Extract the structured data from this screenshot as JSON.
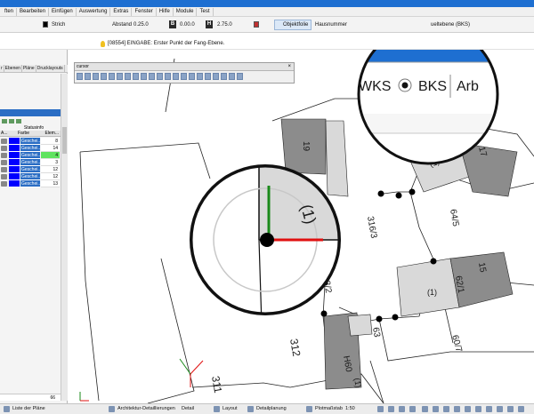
{
  "menu": [
    "ften",
    "Bearbeiten",
    "Einfügen",
    "Auswertung",
    "Extras",
    "Fenster",
    "Hilfe",
    "Module",
    "Test"
  ],
  "props": {
    "line_type": "Strich",
    "abstand_label": "Abstand",
    "abstand_value": "0.25.0",
    "b_label": "B",
    "b_value": "0.00.0",
    "h_label": "H",
    "h_value": "2.75.0",
    "objektfolie": "Objektfolie",
    "hausnummer": "Hausnummer",
    "ebene": "ueltebene (BKS)"
  },
  "status": {
    "message": "[08554] EINGABE: Erster Punkt der Fang-Ebene."
  },
  "left_panel": {
    "tabs": [
      "Ebenen",
      "Pläne",
      "Drucklayouts"
    ],
    "tab_prefix": "r",
    "statusinfo": "Statusinfo",
    "col_farbe": "Farbe",
    "col_elem": "Elem...",
    "col_a": "A...",
    "rows": [
      {
        "name": "Geschei...",
        "count": "8",
        "selected": false
      },
      {
        "name": "Geschei...",
        "count": "14",
        "selected": false
      },
      {
        "name": "Geschei...",
        "count": "4",
        "selected": true
      },
      {
        "name": "Geschei...",
        "count": "3",
        "selected": false
      },
      {
        "name": "Geschei...",
        "count": "12",
        "selected": false
      },
      {
        "name": "Geschei...",
        "count": "12",
        "selected": false
      },
      {
        "name": "Geschei...",
        "count": "13",
        "selected": false
      }
    ],
    "footer_count": "66"
  },
  "cursor_toolbar": {
    "title": "cursor"
  },
  "magnifier": {
    "wks": "WKS",
    "bks": "BKS",
    "arb": "Arb",
    "bks_selected": true,
    "zoom_label": "(1)"
  },
  "plan_labels": {
    "l19": "19",
    "l17": "17",
    "l1a": "(1)",
    "l316": "316/3",
    "l645": "64/5",
    "l15": "15",
    "l621": "62/1",
    "l1b": "(1)",
    "l632": "63/2",
    "l63": "63",
    "l607": "60/7",
    "l312": "312",
    "l311": "311",
    "lh60": "H60",
    "l13": "(1)"
  },
  "bottom": {
    "liste": "Liste der Pläne",
    "architektur": "Architektur-Detaillierungen",
    "detail": "Detail",
    "layout": "Layout",
    "detailplanung": "Detailplanung",
    "plotmassstab": "Plotmaßstab",
    "scale": "1:50"
  },
  "colors": {
    "titlebar": "#1e6fd1",
    "layer_blue": "#0000ff",
    "selected_green": "#5fe35f",
    "building_gray": "#d9d9d9",
    "building_dark": "#8c8c8c",
    "axis_green": "#1a8a1a",
    "axis_red": "#e01010"
  }
}
